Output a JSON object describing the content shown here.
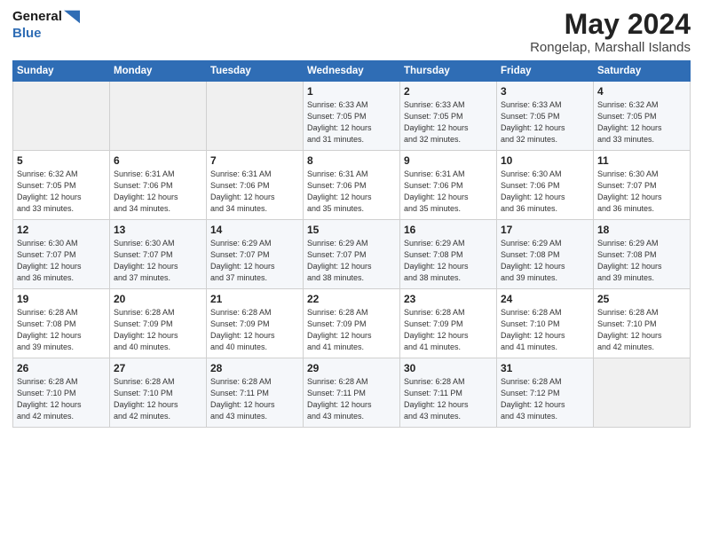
{
  "header": {
    "title": "May 2024",
    "subtitle": "Rongelap, Marshall Islands"
  },
  "columns": [
    "Sunday",
    "Monday",
    "Tuesday",
    "Wednesday",
    "Thursday",
    "Friday",
    "Saturday"
  ],
  "weeks": [
    [
      {
        "day": "",
        "info": ""
      },
      {
        "day": "",
        "info": ""
      },
      {
        "day": "",
        "info": ""
      },
      {
        "day": "1",
        "info": "Sunrise: 6:33 AM\nSunset: 7:05 PM\nDaylight: 12 hours\nand 31 minutes."
      },
      {
        "day": "2",
        "info": "Sunrise: 6:33 AM\nSunset: 7:05 PM\nDaylight: 12 hours\nand 32 minutes."
      },
      {
        "day": "3",
        "info": "Sunrise: 6:33 AM\nSunset: 7:05 PM\nDaylight: 12 hours\nand 32 minutes."
      },
      {
        "day": "4",
        "info": "Sunrise: 6:32 AM\nSunset: 7:05 PM\nDaylight: 12 hours\nand 33 minutes."
      }
    ],
    [
      {
        "day": "5",
        "info": "Sunrise: 6:32 AM\nSunset: 7:05 PM\nDaylight: 12 hours\nand 33 minutes."
      },
      {
        "day": "6",
        "info": "Sunrise: 6:31 AM\nSunset: 7:06 PM\nDaylight: 12 hours\nand 34 minutes."
      },
      {
        "day": "7",
        "info": "Sunrise: 6:31 AM\nSunset: 7:06 PM\nDaylight: 12 hours\nand 34 minutes."
      },
      {
        "day": "8",
        "info": "Sunrise: 6:31 AM\nSunset: 7:06 PM\nDaylight: 12 hours\nand 35 minutes."
      },
      {
        "day": "9",
        "info": "Sunrise: 6:31 AM\nSunset: 7:06 PM\nDaylight: 12 hours\nand 35 minutes."
      },
      {
        "day": "10",
        "info": "Sunrise: 6:30 AM\nSunset: 7:06 PM\nDaylight: 12 hours\nand 36 minutes."
      },
      {
        "day": "11",
        "info": "Sunrise: 6:30 AM\nSunset: 7:07 PM\nDaylight: 12 hours\nand 36 minutes."
      }
    ],
    [
      {
        "day": "12",
        "info": "Sunrise: 6:30 AM\nSunset: 7:07 PM\nDaylight: 12 hours\nand 36 minutes."
      },
      {
        "day": "13",
        "info": "Sunrise: 6:30 AM\nSunset: 7:07 PM\nDaylight: 12 hours\nand 37 minutes."
      },
      {
        "day": "14",
        "info": "Sunrise: 6:29 AM\nSunset: 7:07 PM\nDaylight: 12 hours\nand 37 minutes."
      },
      {
        "day": "15",
        "info": "Sunrise: 6:29 AM\nSunset: 7:07 PM\nDaylight: 12 hours\nand 38 minutes."
      },
      {
        "day": "16",
        "info": "Sunrise: 6:29 AM\nSunset: 7:08 PM\nDaylight: 12 hours\nand 38 minutes."
      },
      {
        "day": "17",
        "info": "Sunrise: 6:29 AM\nSunset: 7:08 PM\nDaylight: 12 hours\nand 39 minutes."
      },
      {
        "day": "18",
        "info": "Sunrise: 6:29 AM\nSunset: 7:08 PM\nDaylight: 12 hours\nand 39 minutes."
      }
    ],
    [
      {
        "day": "19",
        "info": "Sunrise: 6:28 AM\nSunset: 7:08 PM\nDaylight: 12 hours\nand 39 minutes."
      },
      {
        "day": "20",
        "info": "Sunrise: 6:28 AM\nSunset: 7:09 PM\nDaylight: 12 hours\nand 40 minutes."
      },
      {
        "day": "21",
        "info": "Sunrise: 6:28 AM\nSunset: 7:09 PM\nDaylight: 12 hours\nand 40 minutes."
      },
      {
        "day": "22",
        "info": "Sunrise: 6:28 AM\nSunset: 7:09 PM\nDaylight: 12 hours\nand 41 minutes."
      },
      {
        "day": "23",
        "info": "Sunrise: 6:28 AM\nSunset: 7:09 PM\nDaylight: 12 hours\nand 41 minutes."
      },
      {
        "day": "24",
        "info": "Sunrise: 6:28 AM\nSunset: 7:10 PM\nDaylight: 12 hours\nand 41 minutes."
      },
      {
        "day": "25",
        "info": "Sunrise: 6:28 AM\nSunset: 7:10 PM\nDaylight: 12 hours\nand 42 minutes."
      }
    ],
    [
      {
        "day": "26",
        "info": "Sunrise: 6:28 AM\nSunset: 7:10 PM\nDaylight: 12 hours\nand 42 minutes."
      },
      {
        "day": "27",
        "info": "Sunrise: 6:28 AM\nSunset: 7:10 PM\nDaylight: 12 hours\nand 42 minutes."
      },
      {
        "day": "28",
        "info": "Sunrise: 6:28 AM\nSunset: 7:11 PM\nDaylight: 12 hours\nand 43 minutes."
      },
      {
        "day": "29",
        "info": "Sunrise: 6:28 AM\nSunset: 7:11 PM\nDaylight: 12 hours\nand 43 minutes."
      },
      {
        "day": "30",
        "info": "Sunrise: 6:28 AM\nSunset: 7:11 PM\nDaylight: 12 hours\nand 43 minutes."
      },
      {
        "day": "31",
        "info": "Sunrise: 6:28 AM\nSunset: 7:12 PM\nDaylight: 12 hours\nand 43 minutes."
      },
      {
        "day": "",
        "info": ""
      }
    ]
  ]
}
